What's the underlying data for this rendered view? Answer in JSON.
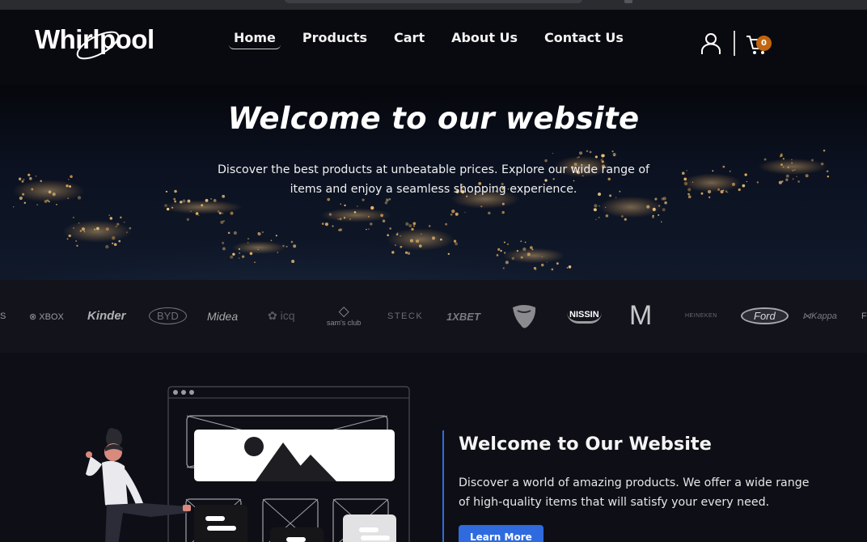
{
  "brand": {
    "name": "Whirlpool"
  },
  "nav": {
    "links": [
      {
        "label": "Home",
        "active": true
      },
      {
        "label": "Products"
      },
      {
        "label": "Cart"
      },
      {
        "label": "About Us"
      },
      {
        "label": "Contact Us"
      }
    ],
    "cart_count": "0"
  },
  "hero": {
    "title": "Welcome to our website",
    "text": "Discover the best products at unbeatable prices. Explore our wide range of items and enjoy a seamless shopping experience."
  },
  "brands": [
    "XBOX",
    "Kinder",
    "BYD",
    "Midea",
    "icq",
    "sam's club",
    "STECK",
    "1XBET",
    "NISSIN",
    "M",
    "HEINEKEN",
    "Ford",
    "Kappa"
  ],
  "about": {
    "title": "Welcome to Our Website",
    "text": "Discover a world of amazing products. We offer a wide range of high-quality items that will satisfy your every need.",
    "button_label": "Learn More"
  },
  "colors": {
    "accent": "#2f6bde",
    "badge": "#c1660e",
    "background": "#0e0f16"
  }
}
